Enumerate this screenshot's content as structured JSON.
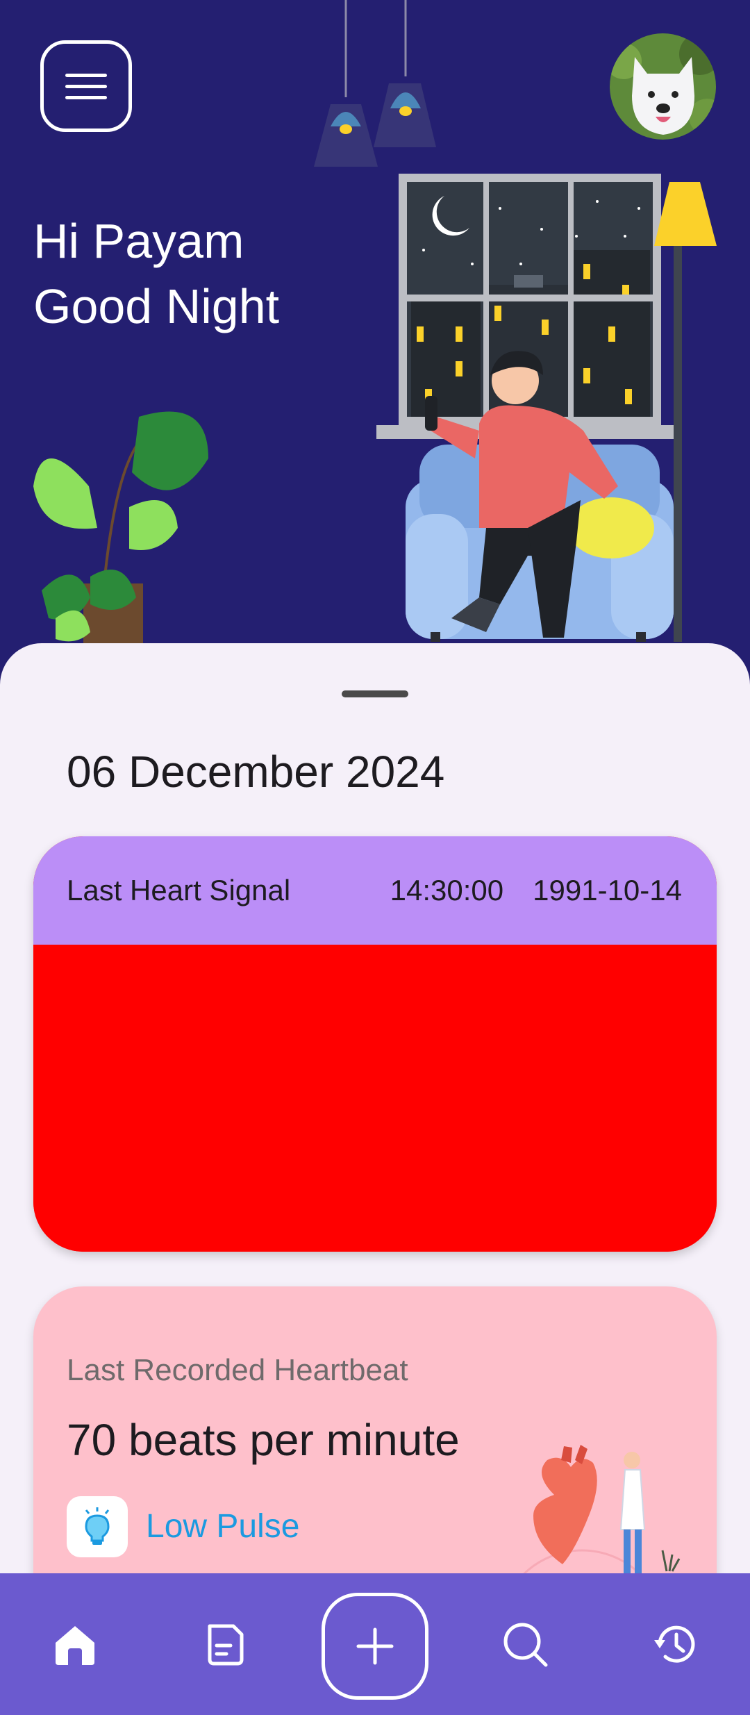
{
  "header": {
    "greeting_line1": "Hi Payam",
    "greeting_line2": "Good Night",
    "menu_icon": "hamburger-menu-icon",
    "avatar_alt": "user-avatar"
  },
  "sheet": {
    "date": "06 December 2024",
    "signal_card": {
      "title": "Last Heart Signal",
      "time": "14:30:00",
      "date": "1991-10-14",
      "header_color": "#bb8ef7",
      "body_color": "#ff0000"
    },
    "heartbeat_card": {
      "label": "Last Recorded Heartbeat",
      "value": "70 beats per minute",
      "status": "Low Pulse",
      "status_icon": "lightbulb-icon",
      "background": "#fec0cb",
      "status_color": "#1b9ae0"
    }
  },
  "bottom_nav": {
    "background": "#6b5acf",
    "items": [
      {
        "icon": "home-icon",
        "active": true
      },
      {
        "icon": "document-icon",
        "active": false
      },
      {
        "icon": "add-icon",
        "active": false
      },
      {
        "icon": "search-icon",
        "active": false
      },
      {
        "icon": "history-icon",
        "active": false
      }
    ]
  },
  "theme": {
    "header_bg": "#241f71",
    "sheet_bg": "#f5f0f9"
  }
}
